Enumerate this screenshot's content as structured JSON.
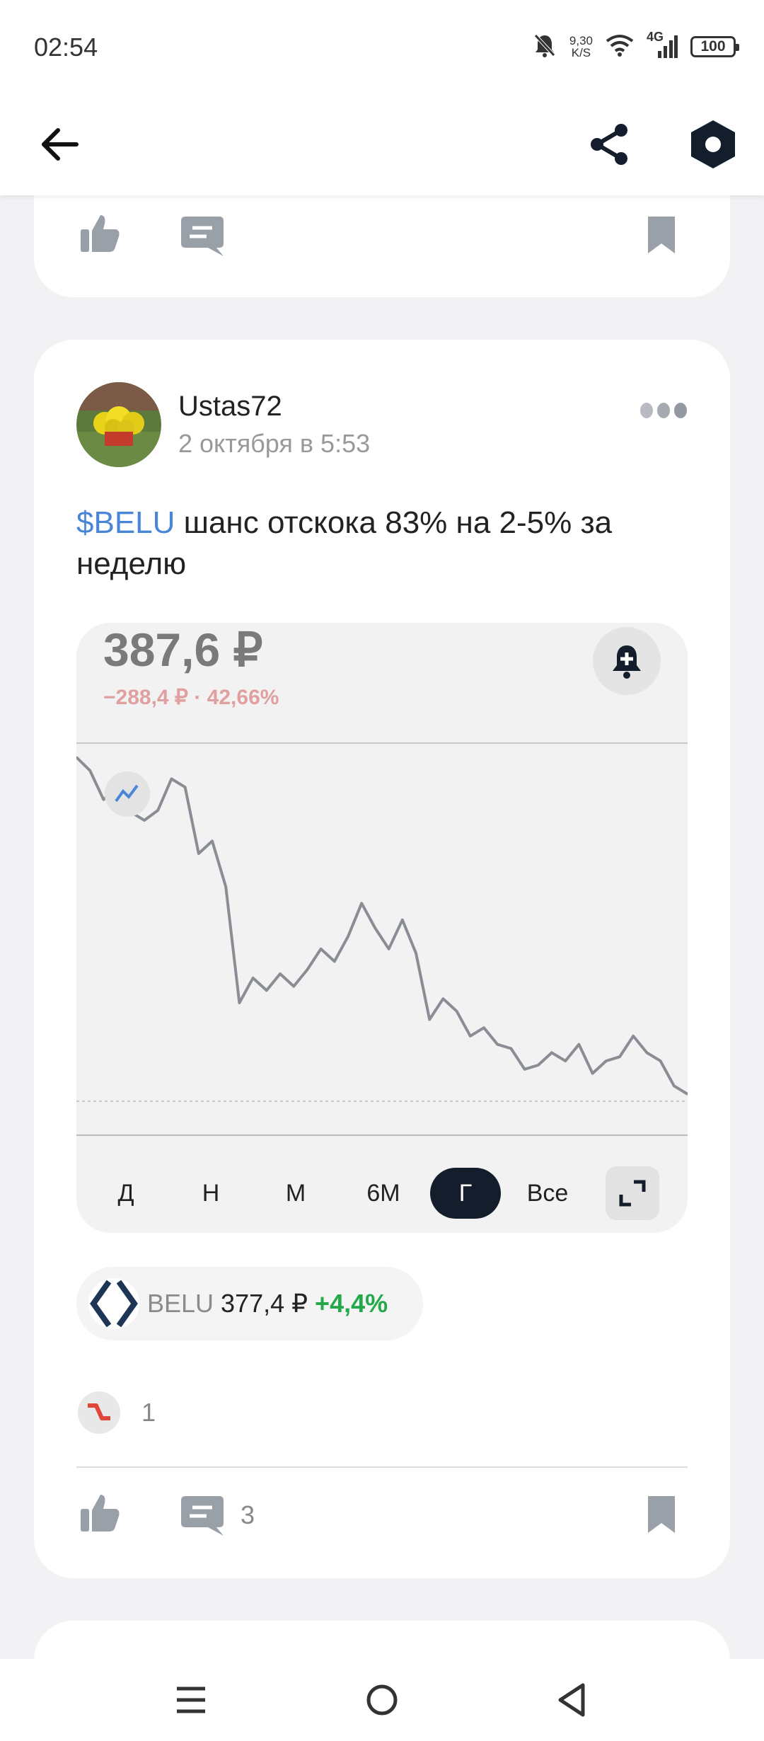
{
  "status_bar": {
    "time": "02:54",
    "net_speed_value": "9,30",
    "net_speed_unit": "K/S",
    "network_type": "4G",
    "battery": "100",
    "icons": [
      "bell-muted-icon",
      "wifi-icon",
      "signal-icon",
      "battery-icon"
    ]
  },
  "header": {
    "icons": [
      "back-arrow-icon",
      "share-icon",
      "hexagon-settings-icon"
    ]
  },
  "prev_card": {
    "icons": [
      "thumbs-up-icon",
      "comment-icon",
      "bookmark-icon"
    ]
  },
  "post": {
    "author": "Ustas72",
    "date": "2 октября в 5:53",
    "ticker_tag": "$BELU",
    "text": " шанс отскока 83% на 2-5% за неделю",
    "chart": {
      "price": "387,6 ₽",
      "change": "−288,4 ₽ · 42,66%",
      "periods": [
        "Д",
        "Н",
        "М",
        "6М",
        "Г",
        "Все"
      ],
      "active_period": "Г"
    },
    "ticker": {
      "symbol": "BELU",
      "price": "377,4 ₽",
      "change": "+4,4%"
    },
    "reaction_count": "1",
    "comments_count": "3"
  },
  "colors": {
    "accent_link": "#4a86d8",
    "positive": "#23a84a",
    "negative_faded": "#e0a0a0",
    "active_pill": "#141d2b",
    "chart_line": "#8a8d93"
  },
  "chart_data": {
    "type": "line",
    "title": "",
    "xlabel": "",
    "ylabel": "",
    "series": [
      {
        "values": [
          676,
          660,
          625,
          640,
          610,
          600,
          612,
          650,
          640,
          560,
          575,
          520,
          380,
          410,
          395,
          415,
          400,
          420,
          445,
          430,
          460,
          500,
          470,
          445,
          480,
          440,
          360,
          385,
          370,
          340,
          350,
          330,
          325,
          300,
          305,
          320,
          310,
          330,
          295,
          310,
          315,
          340,
          320,
          310,
          280,
          270
        ]
      }
    ]
  }
}
